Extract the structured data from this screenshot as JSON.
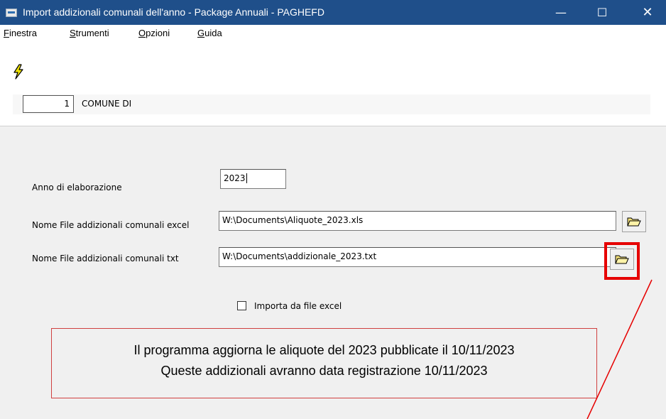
{
  "window": {
    "title": "Import addizionali comunali dell'anno - Package Annuali - PAGHEFD",
    "minimize": "—",
    "maximize": "☐",
    "close": "✕"
  },
  "menu": [
    {
      "accel": "F",
      "rest": "inestra"
    },
    {
      "accel": "S",
      "rest": "trumenti"
    },
    {
      "accel": "O",
      "rest": "pzioni"
    },
    {
      "accel": "G",
      "rest": "uida"
    }
  ],
  "toolbar": {
    "icon": "lightning-icon"
  },
  "header": {
    "code": "1",
    "comune_label": "COMUNE DI"
  },
  "form": {
    "anno_label": "Anno di elaborazione",
    "anno_value": "2023",
    "excel_label": "Nome File addizionali comunali excel",
    "excel_value": "W:\\Documents\\Aliquote_2023.xls",
    "txt_label": "Nome File addizionali comunali txt",
    "txt_value": "W:\\Documents\\addizionale_2023.txt",
    "checkbox_label": "Importa da file excel",
    "checkbox_checked": false,
    "browse_icon": "folder-open-icon"
  },
  "note": {
    "line1": "Il programma aggiorna le aliquote del 2023 pubblicate il 10/11/2023",
    "line2": "Queste addizionali avranno data registrazione 10/11/2023"
  },
  "colors": {
    "titlebar": "#1f4f8a",
    "highlight": "#e60000",
    "panel": "#f0f0f0"
  }
}
